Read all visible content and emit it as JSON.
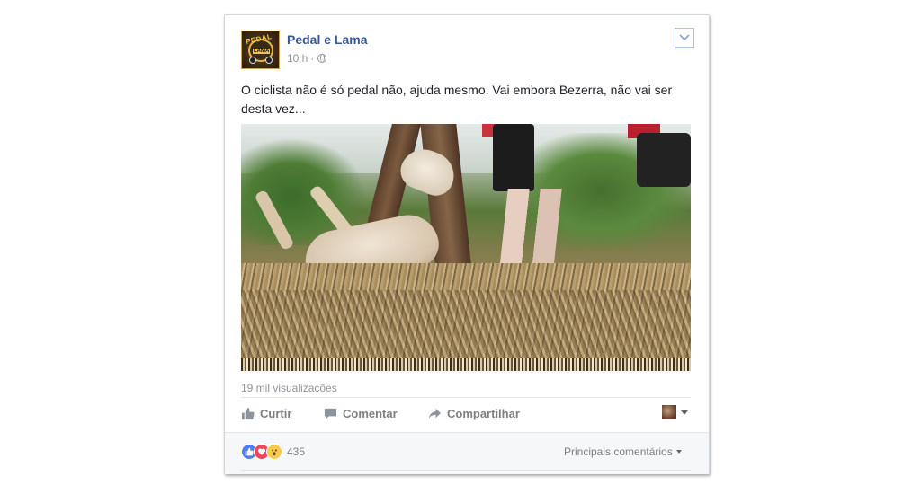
{
  "post": {
    "page_name": "Pedal e Lama",
    "time": "10 h",
    "separator": "·",
    "privacy_icon": "globe-icon",
    "text": "O ciclista não é só pedal não, ajuda mesmo. Vai embora Bezerra, não vai ser desta vez...",
    "avatar": {
      "text_top": "PEDAL",
      "text_mid": "LAMA"
    }
  },
  "video": {
    "views": "19 mil visualizações"
  },
  "actions": {
    "like_label": "Curtir",
    "comment_label": "Comentar",
    "share_label": "Compartilhar",
    "like_icon": "thumbs-up-icon",
    "comment_icon": "speech-bubble-icon",
    "share_icon": "share-arrow-icon"
  },
  "footer": {
    "reaction_count": "435",
    "reactions": [
      "like",
      "love",
      "wow"
    ],
    "sort_label": "Principais comentários"
  },
  "colors": {
    "link_blue": "#365899",
    "muted_gray": "#90949c",
    "like_blue": "#4f7ef0",
    "love_red": "#f0445c",
    "wow_yellow": "#f7cb4d"
  }
}
